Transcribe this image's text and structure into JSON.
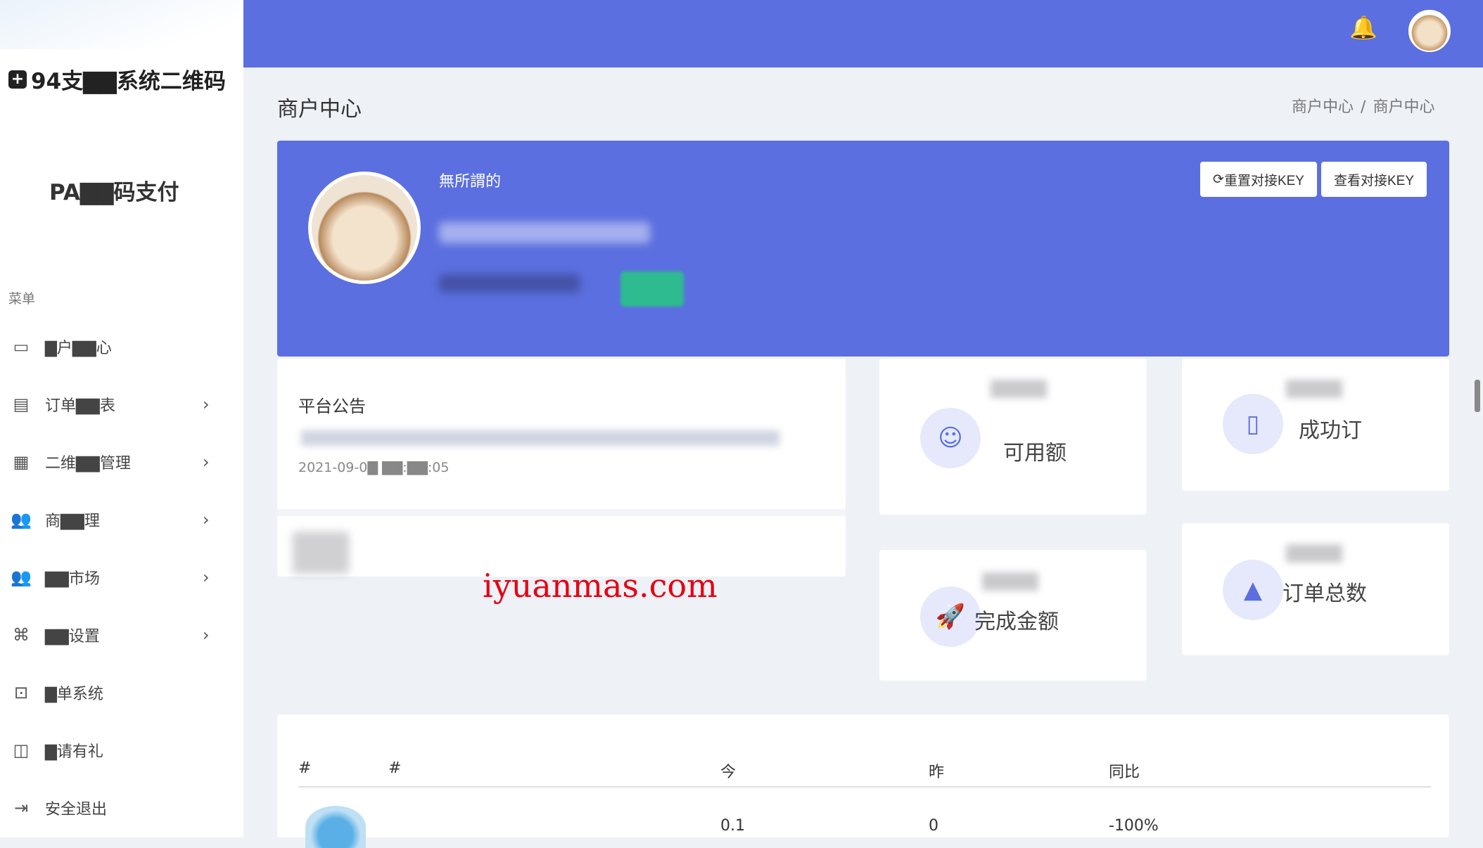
{
  "sidebar": {
    "brand_text": "94支▇▇系统二维码",
    "brand2_text": "PA▇▇码支付",
    "menu_title": "菜单",
    "items": [
      {
        "label": "▇户▇▇心",
        "icon": "monitor-icon",
        "has_chevron": false
      },
      {
        "label": "订单▇▇表",
        "icon": "order-icon",
        "has_chevron": true
      },
      {
        "label": "二维▇▇管理",
        "icon": "qrcode-icon",
        "has_chevron": true
      },
      {
        "label": "商▇▇理",
        "icon": "users-icon",
        "has_chevron": true
      },
      {
        "label": "▇▇市场",
        "icon": "market-icon",
        "has_chevron": true
      },
      {
        "label": "▇▇设置",
        "icon": "command-icon",
        "has_chevron": true
      },
      {
        "label": "▇单系统",
        "icon": "ticket-icon",
        "has_chevron": false
      },
      {
        "label": "▇请有礼",
        "icon": "gift-icon",
        "has_chevron": false
      },
      {
        "label": "安全退出",
        "icon": "logout-icon",
        "has_chevron": false
      }
    ]
  },
  "header": {
    "page_title": "商户中心",
    "breadcrumb": [
      "商户中心",
      "商户中心"
    ]
  },
  "profile": {
    "username": "無所謂的",
    "reset_key_label": "重置对接KEY",
    "view_key_label": "查看对接KEY"
  },
  "notice": {
    "title": "平台公告",
    "date": "2021-09-0▇ ▇▇:▇▇:05"
  },
  "stats": [
    {
      "label": "可用额",
      "icon": "user-icon"
    },
    {
      "label": "成功订",
      "icon": "doc-icon"
    },
    {
      "label": "完成金额",
      "icon": "rocket-icon"
    },
    {
      "label": "订单总数",
      "icon": "basket-icon"
    }
  ],
  "watermark": "iyuanmas.com",
  "table": {
    "headers": [
      "#",
      "#",
      "今",
      "昨",
      "同比"
    ],
    "rows": [
      {
        "today": "0.1",
        "yesterday": "0",
        "compare": "-100%"
      }
    ]
  },
  "colors": {
    "accent": "#5b6fe0",
    "success": "#2dbb8f",
    "bell": "#f5b731",
    "watermark": "#e60012"
  }
}
